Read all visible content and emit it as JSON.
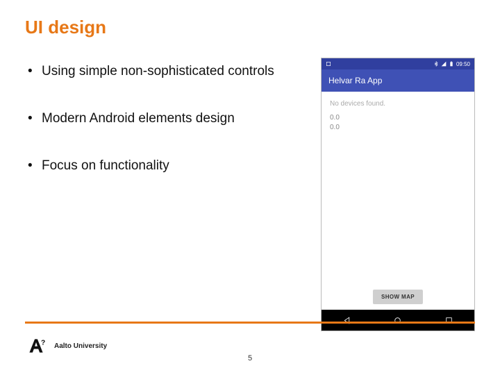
{
  "title": "UI design",
  "bullets": [
    "Using simple non-sophisticated controls",
    "Modern Android elements design",
    "Focus on functionality"
  ],
  "phone": {
    "time": "09:50",
    "app_title": "Helvar Ra App",
    "status_text": "No devices found.",
    "readout1": "0.0",
    "readout2": "0.0",
    "show_map": "SHOW MAP"
  },
  "footer": {
    "university": "Aalto University"
  },
  "page_number": "5"
}
